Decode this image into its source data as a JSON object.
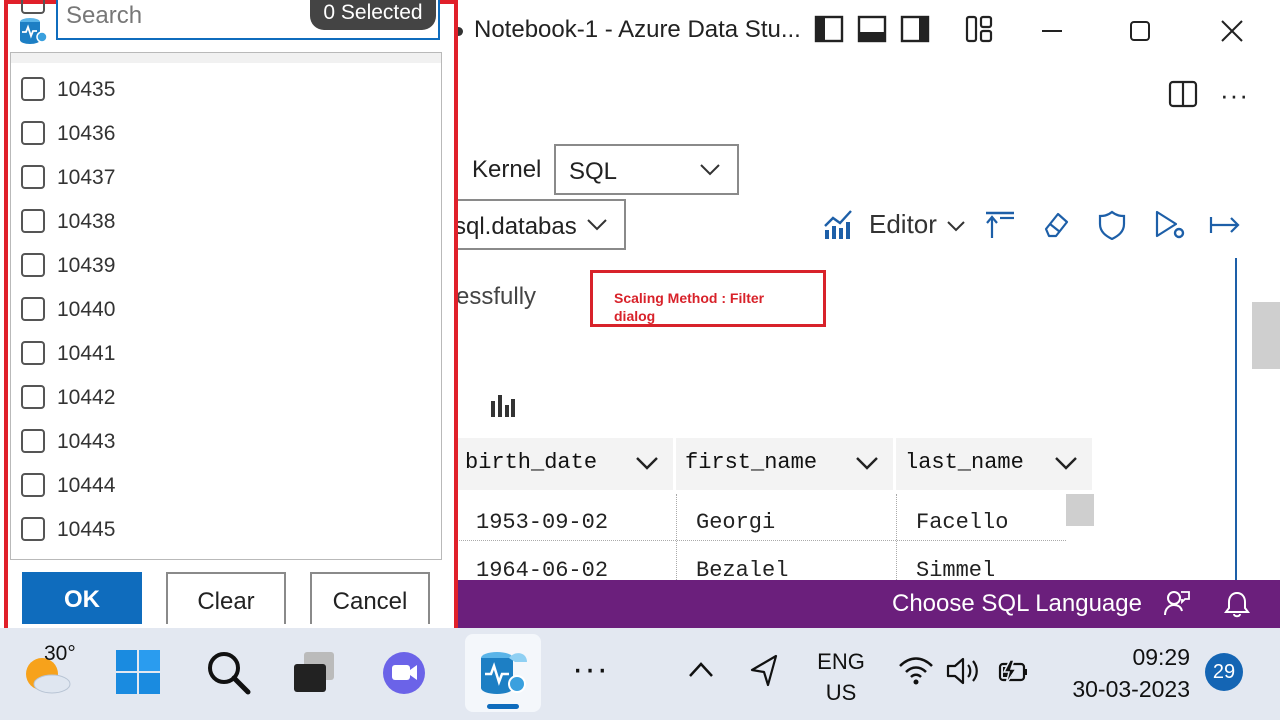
{
  "window": {
    "title": "Notebook-1 - Azure Data Stu..."
  },
  "toolbar": {
    "kernel_label": "Kernel",
    "kernel_value": "SQL",
    "attach_value": "sql.databas",
    "editor_label": "Editor"
  },
  "content": {
    "status_text": "essfully",
    "annotation": "Scaling Method : Filter dialog",
    "columns": [
      "birth_date",
      "first_name",
      "last_name"
    ],
    "rows": [
      [
        "1953-09-02",
        "Georgi",
        "Facello"
      ],
      [
        "1964-06-02",
        "Bezalel",
        "Simmel"
      ]
    ]
  },
  "statusbar": {
    "language": "Choose SQL Language"
  },
  "filter": {
    "search_placeholder": "Search",
    "selected_label": "0 Selected",
    "items": [
      "10435",
      "10436",
      "10437",
      "10438",
      "10439",
      "10440",
      "10441",
      "10442",
      "10443",
      "10444",
      "10445"
    ],
    "ok_label": "OK",
    "clear_label": "Clear",
    "cancel_label": "Cancel"
  },
  "taskbar": {
    "weather_temp": "30°",
    "lang_top": "ENG",
    "lang_bottom": "US",
    "time": "09:29",
    "date": "30-03-2023",
    "notification_count": "29"
  },
  "colors": {
    "accent": "#0f6cbd",
    "statusbar": "#6b1f7c",
    "annotation": "#d8222a"
  }
}
